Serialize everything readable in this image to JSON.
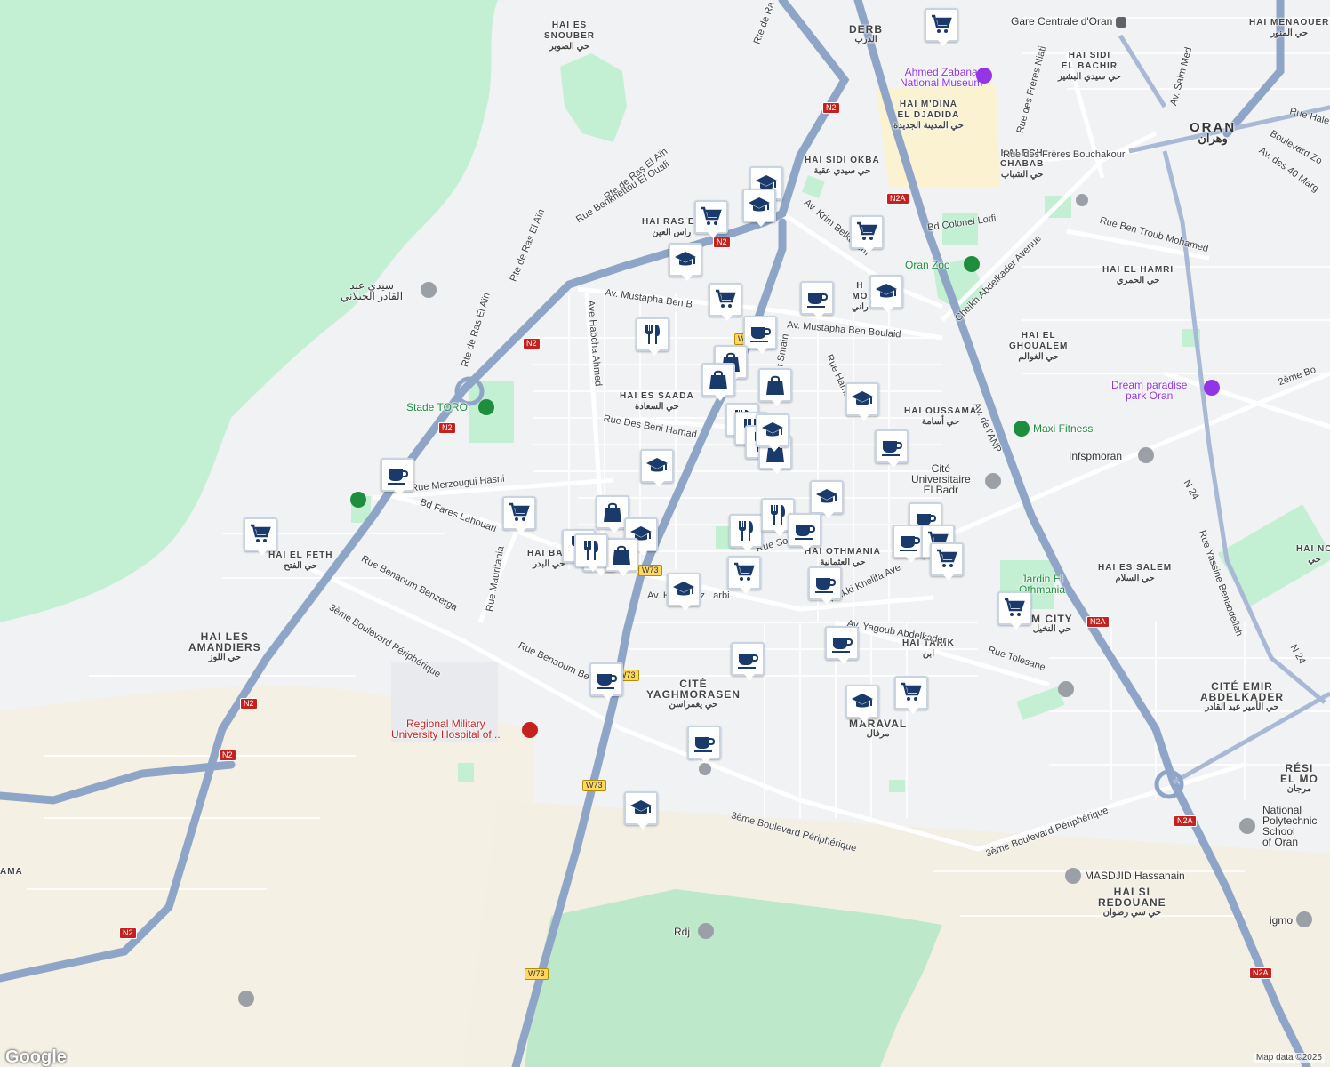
{
  "map": {
    "neighborhoods": [
      {
        "id": "hai-es-snouber",
        "name": "HAI ES\nSNOUBER",
        "ar": "حي الصوبر"
      },
      {
        "id": "derb",
        "name": "DERB",
        "ar": "الدرب"
      },
      {
        "id": "hai-sidi-el-bachir",
        "name": "HAI SIDI\nEL BACHIR",
        "ar": "حي سيدي البشير"
      },
      {
        "id": "hai-mdina",
        "name": "HAI M'DINA\nEL DJADIDA",
        "ar": "حي المدينة الجديدة"
      },
      {
        "id": "hai-menaouer",
        "name": "HAI MENAOUER",
        "ar": "حي المنور"
      },
      {
        "id": "hai-sidi-okba",
        "name": "HAI SIDI OKBA",
        "ar": "حي سيدي عقبة"
      },
      {
        "id": "hai-ech-chabab",
        "name": "HAI ECH\nCHABAB",
        "ar": "حي الشباب"
      },
      {
        "id": "hai-ras-el-ain",
        "name": "HAI RAS EL",
        "ar": "راس العين"
      },
      {
        "id": "hai-el-hamri",
        "name": "HAI EL HAMRI",
        "ar": "حي الحمري"
      },
      {
        "id": "hai-el-ghoualem",
        "name": "HAI EL\nGHOUALEM",
        "ar": "حي الغوالم"
      },
      {
        "id": "hai-es-saada",
        "name": "HAI ES SAADA",
        "ar": "حي السعادة"
      },
      {
        "id": "hai-oussama",
        "name": "HAI OUSSAMA",
        "ar": "حي أسامة"
      },
      {
        "id": "hai-el-feth",
        "name": "HAI EL FETH",
        "ar": "حي الفتح"
      },
      {
        "id": "hai-badr",
        "name": "HAI BAD",
        "ar": "حي البدر"
      },
      {
        "id": "hai-othmania",
        "name": "HAI OTHMANIA",
        "ar": "حي العثمانية"
      },
      {
        "id": "hai-es-salem",
        "name": "HAI ES SALEM",
        "ar": "حي السلام"
      },
      {
        "id": "hai-tarik",
        "name": "HAI TARIK",
        "ar": "ابن"
      },
      {
        "id": "hai-les-amandiers",
        "name": "HAI LES\nAMANDIERS",
        "ar": "حي اللوز"
      },
      {
        "id": "cite-yaghmorasen",
        "name": "CITÉ\nYAGHMORASEN",
        "ar": "حي يغمراسن"
      },
      {
        "id": "maraval",
        "name": "MARAVAL",
        "ar": "مرفال"
      },
      {
        "id": "cite-emir",
        "name": "CITÉ EMIR\nABDELKADER",
        "ar": "حي الأمير عبد القادر"
      },
      {
        "id": "hai-si-redouane",
        "name": "HAI SI\nREDOUANE",
        "ar": "حي سي رضوان"
      },
      {
        "id": "resi-el-mo",
        "name": "RÉSI\nEL MO",
        "ar": "مرجان"
      },
      {
        "id": "hai-no",
        "name": "HAI NO",
        "ar": "حي"
      },
      {
        "id": "m-city",
        "name": "M CITY",
        "ar": "حي النخيل"
      },
      {
        "id": "hai-mo",
        "name": "H\nMO",
        "ar": "راني"
      },
      {
        "id": "ama",
        "name": "AMA",
        "ar": ""
      }
    ],
    "city": {
      "name": "ORAN",
      "ar": "وهران"
    },
    "pois": [
      {
        "id": "gare",
        "name": "Gare Centrale d'Oran",
        "color": "#3c4043",
        "icon": "train-icon"
      },
      {
        "id": "museum",
        "name": "Ahmed Zabana\nNational Museum",
        "color": "#9334e6",
        "icon": "museum-icon"
      },
      {
        "id": "zoo",
        "name": "Oran Zoo",
        "color": "#1e8e3e",
        "icon": "zoo-icon"
      },
      {
        "id": "stade",
        "name": "Stade TORO",
        "color": "#1e8e3e",
        "icon": "stadium-icon"
      },
      {
        "id": "dream",
        "name": "Dream paradise\npark Oran",
        "color": "#9334e6",
        "icon": "amusement-icon"
      },
      {
        "id": "maxi",
        "name": "Maxi Fitness",
        "color": "#1e8e3e",
        "icon": "fitness-icon"
      },
      {
        "id": "infsp",
        "name": "Infspmoran",
        "color": "#5f6368",
        "icon": "school-icon"
      },
      {
        "id": "cite-univ",
        "name": "Cité\nUniversitaire\nEl Badr",
        "color": "#5f6368",
        "icon": "building-icon"
      },
      {
        "id": "jardin",
        "name": "Jardin El\nOthmania",
        "color": "#1e8e3e",
        "icon": ""
      },
      {
        "id": "hospital",
        "name": "Regional Military\nUniversity Hospital of...",
        "color": "#c5221f",
        "icon": "hospital-icon"
      },
      {
        "id": "masjid",
        "name": "MASDJID Hassanain",
        "color": "#5f6368",
        "icon": "mosque-icon"
      },
      {
        "id": "rdj",
        "name": "Rdj",
        "color": "#5f6368",
        "icon": "landmark-icon"
      },
      {
        "id": "polytech",
        "name": "National\nPolytechnic\nSchool\nof Oran",
        "color": "#5f6368",
        "icon": "school-icon"
      },
      {
        "id": "igmo",
        "name": "igmo",
        "color": "#5f6368",
        "icon": "landmark-icon"
      },
      {
        "id": "sidi-abdelkader",
        "name": "سيدي عبد\nالقادر الجيلاني",
        "color": "#5f6368",
        "icon": "landmark-icon"
      }
    ],
    "roads": [
      {
        "id": "rte-ras-el-ain-1",
        "name": "Rte de Ras El Aïn"
      },
      {
        "id": "rte-ras-el-ain-2",
        "name": "Rte de Ras El Aïn"
      },
      {
        "id": "rte-ras-el-ain-3",
        "name": "Rte de Ras El Aïn"
      },
      {
        "id": "rue-benkhettou",
        "name": "Rue Benkhettou El Ouafi"
      },
      {
        "id": "rte-ra",
        "name": "Rte de Ra"
      },
      {
        "id": "av-mustapha-1",
        "name": "Av. Mustapha Ben B"
      },
      {
        "id": "av-mustapha-2",
        "name": "Av. Mustapha Ben Boulaid"
      },
      {
        "id": "av-krim",
        "name": "Av. Krim Belkacem"
      },
      {
        "id": "bd-colonel",
        "name": "Bd Colonel Lotfi"
      },
      {
        "id": "cheikh",
        "name": "Cheikh Abdelkader Avenue"
      },
      {
        "id": "rue-ben-troub",
        "name": "Rue Ben Troub Mohamed"
      },
      {
        "id": "rue-freres-b",
        "name": "Rue des Frères Bouchakour"
      },
      {
        "id": "rue-freres-n",
        "name": "Rue des Freres Niati"
      },
      {
        "id": "av-saim",
        "name": "Av. Saim Med"
      },
      {
        "id": "av-40",
        "name": "Av. des 40 Marg"
      },
      {
        "id": "rue-hale",
        "name": "Rue Hale"
      },
      {
        "id": "bd-zo",
        "name": "Boulevard Zo"
      },
      {
        "id": "ave-habcha",
        "name": "Ave Habcha Ahmed"
      },
      {
        "id": "rue-beni-hamad",
        "name": "Rue Des Beni Hamad"
      },
      {
        "id": "rue-merzougui",
        "name": "Rue Merzougui Hasni"
      },
      {
        "id": "bd-fares",
        "name": "Bd Fares Lahouari"
      },
      {
        "id": "rue-mauritania",
        "name": "Rue Mauritania"
      },
      {
        "id": "rue-benaoum-1",
        "name": "Rue Benaoum Benzerga"
      },
      {
        "id": "rue-benaoum-2",
        "name": "Rue Benaoum Benzerga"
      },
      {
        "id": "3eme-1",
        "name": "3ème Boulevard Périphérique"
      },
      {
        "id": "3eme-2",
        "name": "3ème Boulevard Périphérique"
      },
      {
        "id": "3eme-3",
        "name": "3ème Boulevard Périphérique"
      },
      {
        "id": "av-hamdouz",
        "name": "Av. Hamdouz Larbi"
      },
      {
        "id": "mekki",
        "name": "Mekki Khelifa Ave"
      },
      {
        "id": "av-yagoub",
        "name": "Av. Yagoub Abdelkader"
      },
      {
        "id": "rue-tolesane",
        "name": "Rue Tolesane"
      },
      {
        "id": "rue-soum",
        "name": "Rue Sou"
      },
      {
        "id": "av-anp",
        "name": "Av. de l'ANP"
      },
      {
        "id": "n24",
        "name": "N 24"
      },
      {
        "id": "rue-yassine",
        "name": "Rue Yassine Benabdellah"
      },
      {
        "id": "2eme",
        "name": "2ème Bo"
      },
      {
        "id": "rue-haman",
        "name": "Rue Haman"
      },
      {
        "id": "smain",
        "name": "t Smain"
      }
    ],
    "shields": [
      "N2",
      "N2",
      "N2",
      "N2",
      "N2",
      "N2",
      "N2",
      "N2A",
      "N2A",
      "N2A",
      "N2A",
      "W73",
      "W73",
      "W73",
      "W73",
      "W"
    ],
    "markers": [
      {
        "type": "shopping-cart",
        "name": "supermarket-marker"
      },
      {
        "type": "school",
        "name": "school-marker"
      },
      {
        "type": "school",
        "name": "school-marker"
      },
      {
        "type": "shopping-cart",
        "name": "supermarket-marker"
      },
      {
        "type": "shopping-cart",
        "name": "supermarket-marker"
      },
      {
        "type": "school",
        "name": "school-marker"
      },
      {
        "type": "shopping-cart",
        "name": "supermarket-marker"
      },
      {
        "type": "cafe",
        "name": "cafe-marker"
      },
      {
        "type": "school",
        "name": "school-marker"
      },
      {
        "type": "restaurant",
        "name": "restaurant-marker"
      },
      {
        "type": "cafe",
        "name": "cafe-marker"
      },
      {
        "type": "shopping-bag",
        "name": "shop-marker"
      },
      {
        "type": "shopping-bag",
        "name": "shop-marker"
      },
      {
        "type": "shopping-bag",
        "name": "shop-marker"
      },
      {
        "type": "school",
        "name": "school-marker"
      },
      {
        "type": "restaurant",
        "name": "restaurant-marker"
      },
      {
        "type": "restaurant",
        "name": "restaurant-marker"
      },
      {
        "type": "restaurant",
        "name": "restaurant-marker"
      },
      {
        "type": "shopping-bag",
        "name": "shop-marker"
      },
      {
        "type": "cafe",
        "name": "cafe-marker"
      },
      {
        "type": "school",
        "name": "school-marker"
      },
      {
        "type": "cafe",
        "name": "cafe-marker"
      },
      {
        "type": "shopping-cart",
        "name": "supermarket-marker"
      },
      {
        "type": "restaurant",
        "name": "restaurant-marker"
      },
      {
        "type": "shopping-bag",
        "name": "shop-marker"
      },
      {
        "type": "school",
        "name": "school-marker"
      },
      {
        "type": "restaurant",
        "name": "restaurant-marker"
      },
      {
        "type": "restaurant",
        "name": "restaurant-marker"
      },
      {
        "type": "shopping-bag",
        "name": "shop-marker"
      },
      {
        "type": "school",
        "name": "school-marker"
      },
      {
        "type": "restaurant",
        "name": "restaurant-marker"
      },
      {
        "type": "restaurant",
        "name": "restaurant-marker"
      },
      {
        "type": "cafe",
        "name": "cafe-marker"
      },
      {
        "type": "school",
        "name": "school-marker"
      },
      {
        "type": "shopping-cart",
        "name": "supermarket-marker"
      },
      {
        "type": "cafe",
        "name": "cafe-marker"
      },
      {
        "type": "cafe",
        "name": "cafe-marker"
      },
      {
        "type": "cafe",
        "name": "cafe-marker"
      },
      {
        "type": "cafe",
        "name": "cafe-marker"
      },
      {
        "type": "shopping-cart",
        "name": "supermarket-marker"
      },
      {
        "type": "shopping-cart",
        "name": "supermarket-marker"
      },
      {
        "type": "shopping-cart",
        "name": "supermarket-marker"
      },
      {
        "type": "cafe",
        "name": "cafe-marker"
      },
      {
        "type": "cafe",
        "name": "cafe-marker"
      },
      {
        "type": "shopping-cart",
        "name": "supermarket-marker"
      },
      {
        "type": "school",
        "name": "school-marker"
      },
      {
        "type": "shopping-cart",
        "name": "supermarket-marker"
      },
      {
        "type": "school",
        "name": "school-marker"
      },
      {
        "type": "cafe",
        "name": "cafe-marker"
      },
      {
        "type": "school",
        "name": "school-marker"
      }
    ],
    "branding": {
      "logo": "Google",
      "attribution": "Map data ©2025"
    },
    "colors": {
      "park": "#c3efd3",
      "urban": "#f1f2f4",
      "highway": "#8fa5c7",
      "road": "#ffffff",
      "marker_icon": "#1a3a6b",
      "sand": "#f5f0e4"
    }
  }
}
